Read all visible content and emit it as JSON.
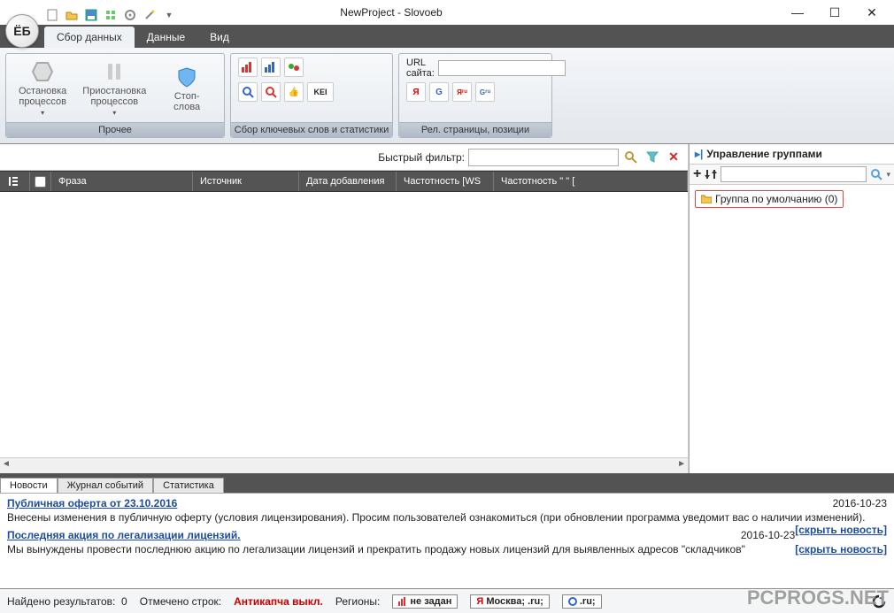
{
  "title": "NewProject - Slovoeb",
  "orb": "ЁБ",
  "tabs": {
    "data_collection": "Сбор данных",
    "data": "Данные",
    "view": "Вид"
  },
  "ribbon": {
    "group1": {
      "caption": "Прочее",
      "stop_processes": "Остановка\nпроцессов",
      "pause_processes": "Приостановка\nпроцессов",
      "stop_words": "Стоп-слова"
    },
    "group2": {
      "caption": "Сбор ключевых слов и статистики",
      "kei": "KEI"
    },
    "group3": {
      "caption": "Рел. страницы, позиции",
      "url_label": "URL сайта:"
    }
  },
  "filter": {
    "label": "Быстрый фильтр:",
    "value": ""
  },
  "grid": {
    "headers": {
      "phrase": "Фраза",
      "source": "Источник",
      "date_added": "Дата добавления",
      "freq_ws": "Частотность [WS",
      "freq2": "Частотность \" \" ["
    }
  },
  "right": {
    "title": "Управление группами",
    "default_group": "Группа по умолчанию (0)"
  },
  "bottom_tabs": {
    "news": "Новости",
    "log": "Журнал событий",
    "stats": "Статистика"
  },
  "news": {
    "item1": {
      "title": "Публичная оферта от 23.10.2016",
      "date": "2016-10-23",
      "body": "Внесены изменения в публичную оферту (условия лицензирования). Просим пользователей ознакомиться (при обновлении программа уведомит вас о наличии изменений).",
      "hide": "[скрыть новость]"
    },
    "item2": {
      "title": "Последняя акция по легализации лицензий.",
      "date": "2016-10-23",
      "body": "Мы вынуждены провести последнюю акцию по легализации лицензий и прекратить продажу новых лицензий для выявленных адресов \"складчиков\"",
      "hide": "[скрыть новость]"
    }
  },
  "status": {
    "results_found": "Найдено результатов:",
    "results_count": "0",
    "rows_marked": "Отмечено строк:",
    "anticaptcha": "Антикапча выкл.",
    "regions_label": "Регионы:",
    "r1": "не задан",
    "r2": "Москва; .ru;",
    "r3": ".ru;"
  },
  "watermark": "PCPROGS.NET"
}
